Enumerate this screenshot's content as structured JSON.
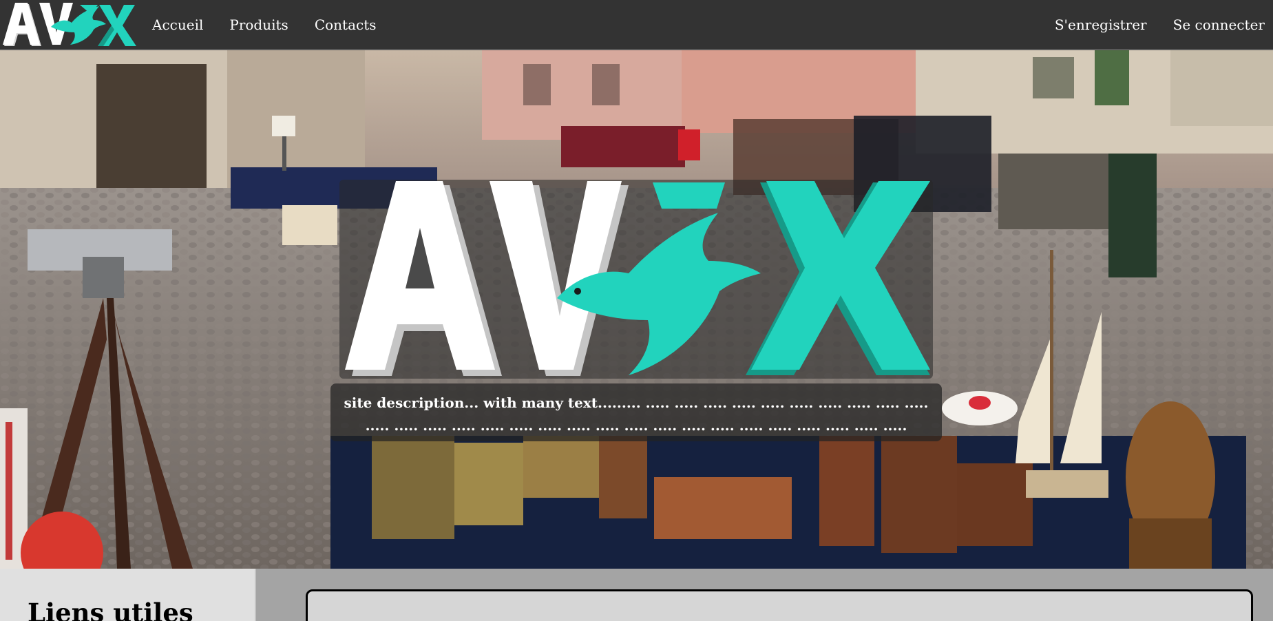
{
  "nav": {
    "brand": "AVEX",
    "links": [
      "Accueil",
      "Produits",
      "Contacts"
    ],
    "right_links": [
      "S'enregistrer",
      "Se connecter"
    ]
  },
  "hero": {
    "logo": "AVEX",
    "description": "site description... with many text......... ..... ..... ..... ..... ..... ..... ..... ..... ..... ..... ..... ..... ..... ..... ..... ..... ..... ..... ..... ..... ..... ..... ..... ..... ..... ..... ..... ..... ....."
  },
  "sidebar": {
    "title": "Liens utiles"
  },
  "colors": {
    "navbar": "#333333",
    "brand_teal": "#22d3bd",
    "brand_teal_dark": "#169a88",
    "brand_white": "#ffffff",
    "sidebar_bg": "#e0e0e0",
    "content_bg": "#a4a4a4",
    "card_bg": "#d6d6d6"
  },
  "icons": {
    "brand_logo": "avex-bird-logo",
    "hero_logo": "avex-bird-logo-large"
  }
}
